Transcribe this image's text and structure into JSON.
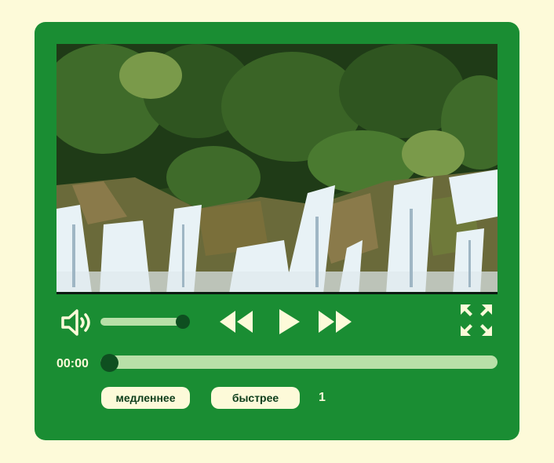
{
  "player": {
    "video": {
      "scene": "waterfall-forest-video-frame",
      "colors": {
        "sky": "#e6eef2",
        "forest_dark": "#1f3b17",
        "forest_mid": "#3f6b2a",
        "forest_light": "#7a9a4a",
        "rock": "#8a7a4a",
        "water": "#e8f2f6",
        "water_shadow": "#9fb6c4"
      }
    },
    "controls": {
      "volume": {
        "icon": "speaker-icon",
        "level": 0.97
      },
      "rewind": {
        "icon": "rewind-icon"
      },
      "play": {
        "icon": "play-icon"
      },
      "forward": {
        "icon": "fast-forward-icon"
      },
      "fullscreen": {
        "icon": "fullscreen-icon"
      },
      "time": "00:00",
      "progress": 0,
      "slower_label": "медленнее",
      "faster_label": "быстрее",
      "speed_value": "1"
    },
    "colors": {
      "panel": "#1a8d33",
      "page_background": "#fdfad9",
      "track": "#b8e0a8",
      "thumb": "#0e4f20",
      "icon": "#fdfad9"
    }
  }
}
